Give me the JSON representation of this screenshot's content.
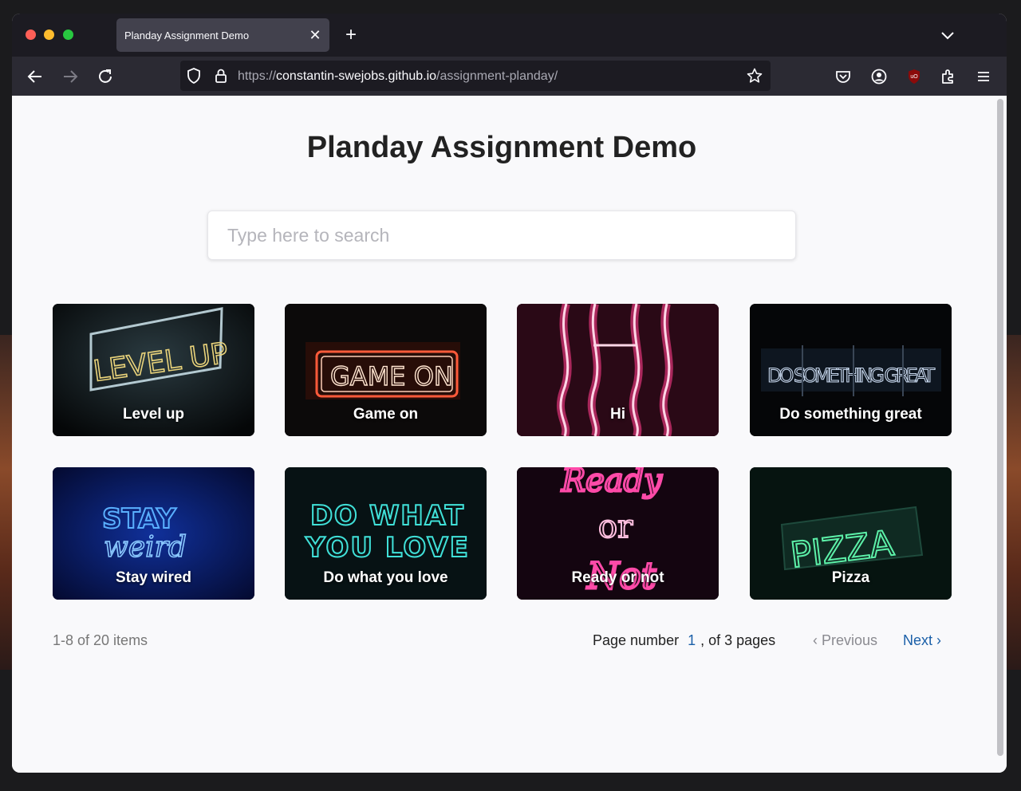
{
  "browser": {
    "tab_title": "Planday Assignment Demo",
    "url_scheme": "https://",
    "url_host": "constantin-swejobs.github.io",
    "url_path": "/assignment-planday/"
  },
  "page": {
    "title": "Planday Assignment Demo",
    "search_placeholder": "Type here to search"
  },
  "cards": [
    {
      "label": "Level up",
      "art_text": "LEVEL UP"
    },
    {
      "label": "Game on",
      "art_text": "GAME ON"
    },
    {
      "label": "Hi",
      "art_text": "HI"
    },
    {
      "label": "Do something great",
      "art_text": "DO SOMETHING GREAT"
    },
    {
      "label": "Stay wired",
      "art_text_1": "STAY",
      "art_text_2": "weird"
    },
    {
      "label": "Do what you love",
      "art_text_1": "DO WHAT",
      "art_text_2": "YOU LOVE"
    },
    {
      "label": "Ready or not",
      "art_text_1": "Ready",
      "art_text_2": "or",
      "art_text_3": "Not"
    },
    {
      "label": "Pizza",
      "art_text": "PIZZA"
    }
  ],
  "pagination": {
    "range_text": "1-8 of 20 items",
    "page_prefix": "Page number",
    "current_page": "1",
    "page_suffix": ", of 3 pages",
    "previous_label": "Previous",
    "next_label": "Next"
  },
  "colors": {
    "accent_link": "#1a5fa8",
    "browser_chrome": "#1c1b22",
    "toolbar": "#2b2a33"
  },
  "icons": [
    "back-icon",
    "forward-icon",
    "reload-icon",
    "shield-icon",
    "lock-icon",
    "star-icon",
    "pocket-icon",
    "account-icon",
    "ublock-icon",
    "extensions-icon",
    "menu-icon",
    "chevron-down-icon",
    "close-icon",
    "plus-icon"
  ]
}
